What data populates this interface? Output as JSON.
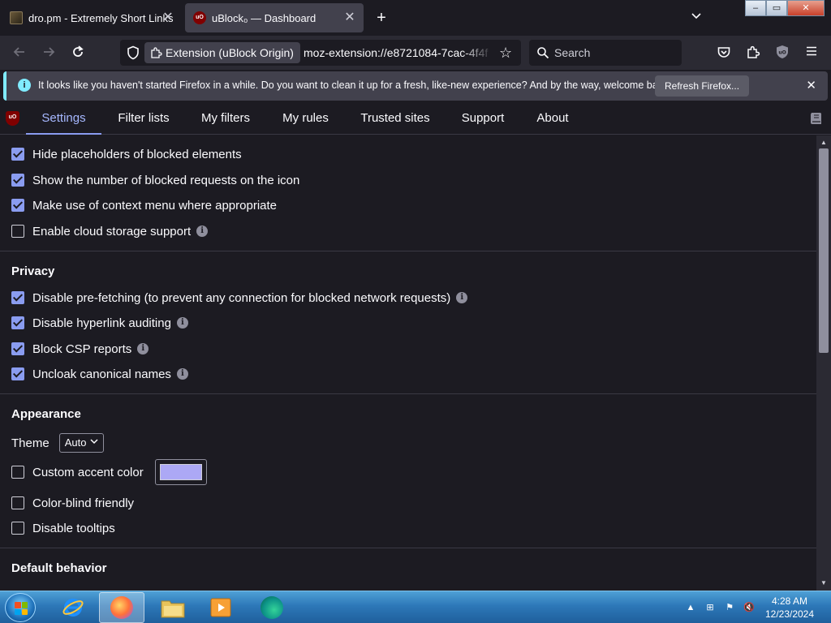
{
  "browser": {
    "tabs": [
      {
        "title": "dro.pm - Extremely Short Links",
        "active": false,
        "favicon": "dro-pm-favicon"
      },
      {
        "title": "uBlock₀ — Dashboard",
        "active": true,
        "favicon": "ublock-favicon"
      }
    ],
    "favicon_text": "uO",
    "new_tab_icon": "plus-icon",
    "window_controls": {
      "minimize": "–",
      "restore": "▭",
      "close": "✕"
    },
    "nav": {
      "identity_label": "Extension (uBlock Origin)",
      "url": "moz-extension://e8721084-7cac-4f4f",
      "search_placeholder": "Search"
    }
  },
  "notification": {
    "icon": "info-icon",
    "info_glyph": "i",
    "message": "It looks like you haven't started Firefox in a while. Do you want to clean it up for a fresh, like-new experience? And by the way, welcome back!",
    "button": "Refresh Firefox...",
    "close_glyph": "✕"
  },
  "dashboard": {
    "logo_text": "uO",
    "tabs": [
      "Settings",
      "Filter lists",
      "My filters",
      "My rules",
      "Trusted sites",
      "Support",
      "About"
    ],
    "active_tab": "Settings",
    "accent": "#8a9cf0",
    "info_glyph": "i",
    "general_options": [
      {
        "label": "Hide placeholders of blocked elements",
        "checked": true,
        "info": false
      },
      {
        "label": "Show the number of blocked requests on the icon",
        "checked": true,
        "info": false
      },
      {
        "label": "Make use of context menu where appropriate",
        "checked": true,
        "info": false
      },
      {
        "label": "Enable cloud storage support",
        "checked": false,
        "info": true
      }
    ],
    "privacy": {
      "title": "Privacy",
      "options": [
        {
          "label": "Disable pre-fetching (to prevent any connection for blocked network requests)",
          "checked": true,
          "info": true
        },
        {
          "label": "Disable hyperlink auditing",
          "checked": true,
          "info": true
        },
        {
          "label": "Block CSP reports",
          "checked": true,
          "info": true
        },
        {
          "label": "Uncloak canonical names",
          "checked": true,
          "info": true
        }
      ]
    },
    "appearance": {
      "title": "Appearance",
      "theme_label": "Theme",
      "theme_value": "Auto",
      "custom_accent_label": "Custom accent color",
      "custom_accent_checked": false,
      "accent_swatch": "#aca8f5",
      "colorblind_label": "Color-blind friendly",
      "colorblind_checked": false,
      "tooltips_label": "Disable tooltips",
      "tooltips_checked": false
    },
    "default_behavior": {
      "title": "Default behavior"
    }
  },
  "taskbar": {
    "apps": [
      "internet-explorer",
      "firefox",
      "file-explorer",
      "media-player",
      "edge-beta"
    ],
    "active_app": "firefox",
    "tray_glyphs": {
      "show_hidden": "▲",
      "network": "⊞",
      "flag": "⚑",
      "volume": "🔇"
    },
    "time": "4:28 AM",
    "date": "12/23/2024"
  }
}
